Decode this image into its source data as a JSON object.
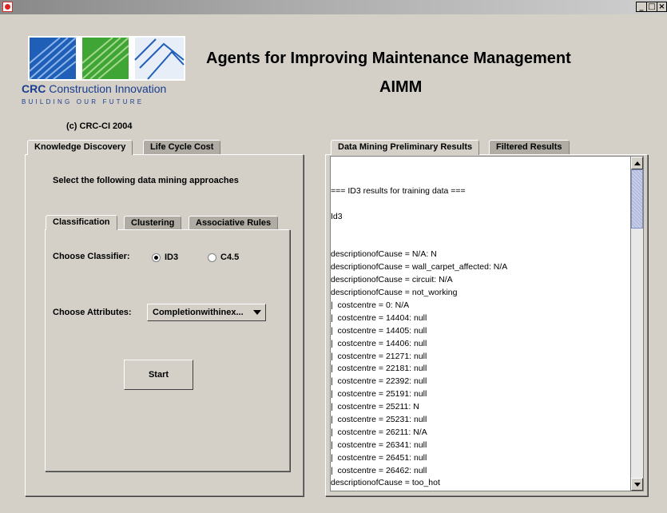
{
  "window": {
    "controls": [
      "_",
      "□",
      "×"
    ]
  },
  "logo": {
    "name_bold": "CRC",
    "name_rest": "Construction Innovation",
    "tagline": "BUILDING OUR FUTURE"
  },
  "copyright": "(c) CRC-CI 2004",
  "header": {
    "title_line1": "Agents for Improving Maintenance Management",
    "title_line2": "AIMM"
  },
  "left_tabs": [
    {
      "label": "Knowledge Discovery",
      "active": true
    },
    {
      "label": "Life Cycle Cost",
      "active": false
    }
  ],
  "section_label": "Select the following data mining approaches",
  "inner_tabs": [
    {
      "label": "Classification",
      "active": true
    },
    {
      "label": "Clustering",
      "active": false
    },
    {
      "label": "Associative Rules",
      "active": false
    }
  ],
  "classifier": {
    "label": "Choose Classifier:",
    "options": [
      {
        "label": "ID3",
        "checked": true
      },
      {
        "label": "C4.5",
        "checked": false
      }
    ]
  },
  "attributes": {
    "label": "Choose Attributes:",
    "selected": "Completionwithinex..."
  },
  "start_button": "Start",
  "right_tabs": [
    {
      "label": "Data Mining Preliminary Results",
      "active": true
    },
    {
      "label": "Filtered Results",
      "active": false
    }
  ],
  "results_lines": [
    "=== ID3 results for training data ===",
    "",
    "Id3",
    "",
    "",
    "descriptionofCause = N/A: N",
    "descriptionofCause = wall_carpet_affected: N/A",
    "descriptionofCause = circuit: N/A",
    "descriptionofCause = not_working",
    "|  costcentre = 0: N/A",
    "|  costcentre = 14404: null",
    "|  costcentre = 14405: null",
    "|  costcentre = 14406: null",
    "|  costcentre = 21271: null",
    "|  costcentre = 22181: null",
    "|  costcentre = 22392: null",
    "|  costcentre = 25191: null",
    "|  costcentre = 25211: N",
    "|  costcentre = 25231: null",
    "|  costcentre = 26211: N/A",
    "|  costcentre = 26341: null",
    "|  costcentre = 26451: null",
    "|  costcentre = 26462: null",
    "descriptionofCause = too_hot"
  ],
  "colors": {
    "window_bg": "#d4d0c8",
    "inactive_tab": "#b0aca4",
    "scroll_thumb": "#aab4d8",
    "logo_blue": "#1a3d8f",
    "logo_green": "#3fa535"
  },
  "icons": [
    "app-icon",
    "minimize-icon",
    "maximize-icon",
    "close-icon",
    "dropdown-arrow-icon",
    "scroll-up-icon",
    "scroll-down-icon"
  ]
}
